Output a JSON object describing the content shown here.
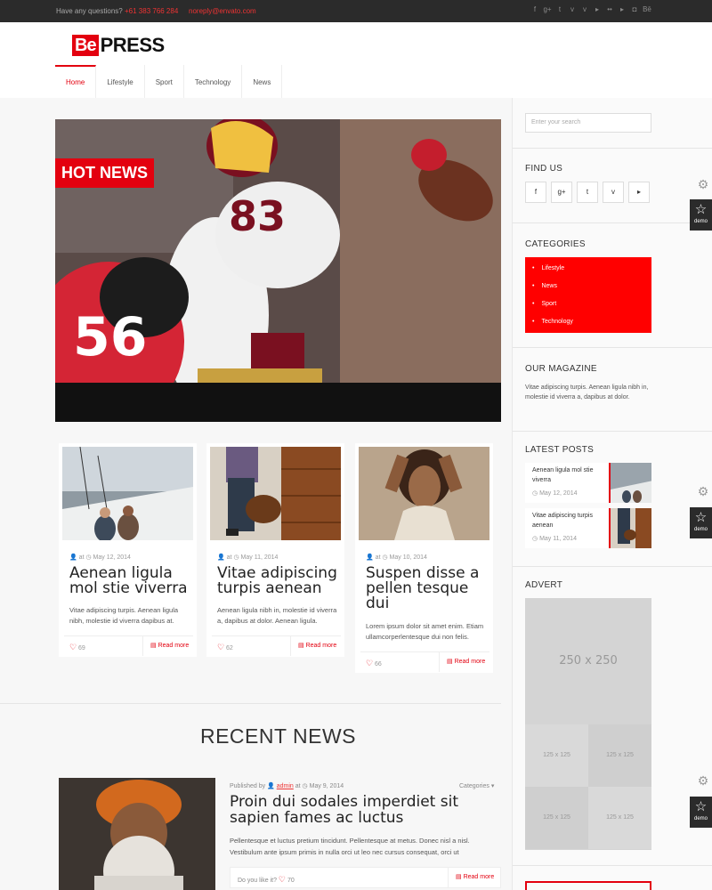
{
  "topbar": {
    "question": "Have any questions?",
    "phone": "+61 383 766 284",
    "email": "noreply@envato.com",
    "socials": [
      "f",
      "g+",
      "t",
      "v",
      "v",
      "▸",
      "••",
      "▸",
      "◘",
      "Bē"
    ]
  },
  "logo": {
    "be": "Be",
    "press": "PRESS"
  },
  "nav": [
    "Home",
    "Lifestyle",
    "Sport",
    "Technology",
    "News"
  ],
  "hero": {
    "badge": "HOT NEWS"
  },
  "cards": [
    {
      "author_at": "at",
      "date": "May 12, 2014",
      "title": "Aenean ligula mol stie viverra",
      "excerpt": "Vitae adipiscing turpis. Aenean ligula nibh, molestie id viverra dapibus at.",
      "likes": "69",
      "more": "Read more"
    },
    {
      "author_at": "at",
      "date": "May 11, 2014",
      "title": "Vitae adipiscing turpis aenean",
      "excerpt": "Aenean ligula nibh in, molestie id viverra a, dapibus at dolor. Aenean ligula.",
      "likes": "62",
      "more": "Read more"
    },
    {
      "author_at": "at",
      "date": "May 10, 2014",
      "title": "Suspen disse a pellen tesque dui",
      "excerpt": "Lorem ipsum dolor sit amet enim. Etiam ullamcorperlentesque dui non felis.",
      "likes": "66",
      "more": "Read more"
    }
  ],
  "recent": {
    "title": "RECENT NEWS",
    "published_by": "Published by",
    "author": "admin",
    "at": "at",
    "date": "May 9, 2014",
    "categories": "Categories",
    "post_title": "Proin dui sodales imperdiet sit sapien fames ac luctus",
    "post_text": "Pellentesque et luctus pretium tincidunt. Pellentesque at metus. Donec nisl a nisl. Vestibulum ante ipsum primis in nulla orci ut leo nec cursus consequat, orci ut",
    "like_label": "Do you like it?",
    "likes": "70",
    "more": "Read more"
  },
  "sidebar": {
    "search_placeholder": "Enter your search",
    "find_us": "FIND US",
    "find_icons": [
      "f",
      "g+",
      "t",
      "v",
      "▸"
    ],
    "categories_title": "CATEGORIES",
    "categories": [
      "Lifestyle",
      "News",
      "Sport",
      "Technology"
    ],
    "magazine_title": "OUR MAGAZINE",
    "magazine_text": "Vitae adipiscing turpis. Aenean ligula nibh in, molestie id viverra a, dapibus at dolor.",
    "latest_title": "LATEST POSTS",
    "latest": [
      {
        "title": "Aenean ligula mol stie viverra",
        "date": "May 12, 2014"
      },
      {
        "title": "Vitae adipiscing turpis aenean",
        "date": "May 11, 2014"
      }
    ],
    "advert_title": "ADVERT",
    "advert_big": "250 x 250",
    "advert_small": [
      "125 x 125",
      "125 x 125",
      "125 x 125",
      "125 x 125"
    ]
  },
  "demo_label": "demo"
}
